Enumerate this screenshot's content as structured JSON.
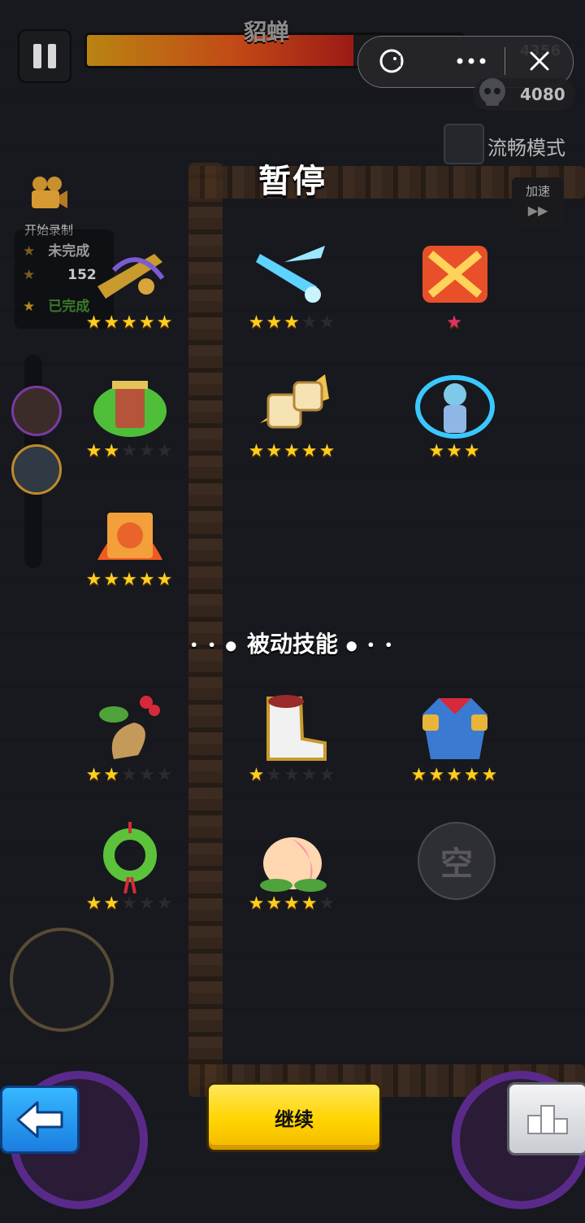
{
  "hud": {
    "boss_name": "貂蝉",
    "boss_hp_fraction": 0.71,
    "coin_count": "4356",
    "kill_count": "4080",
    "smooth_mode_label": "流畅模式",
    "speed_label": "加速",
    "speed_arrows": "▶▶"
  },
  "recording": {
    "label": "开始录制",
    "incomplete_label": "未完成",
    "count": "152",
    "complete_label": "已完成"
  },
  "pause_title": "暂停",
  "active_skills": [
    {
      "name": "golden-crossbow",
      "stars": 5,
      "max": 5
    },
    {
      "name": "ice-blade",
      "stars": 3,
      "max": 5
    },
    {
      "name": "fire-crossed-swords",
      "stars": 1,
      "max": 1,
      "star_color": "#e0326a"
    },
    {
      "name": "green-flame-totem",
      "stars": 2,
      "max": 5
    },
    {
      "name": "golden-dice",
      "stars": 5,
      "max": 5
    },
    {
      "name": "taoist-summon",
      "stars": 3,
      "max": 3
    },
    {
      "name": "fire-scroll",
      "stars": 5,
      "max": 5
    }
  ],
  "passive_title": "被动技能",
  "passive_dots_left": "• • ●",
  "passive_dots_right": "● • •",
  "passive_skills": [
    {
      "name": "ginseng-root",
      "stars": 2,
      "max": 5
    },
    {
      "name": "boots",
      "stars": 1,
      "max": 5
    },
    {
      "name": "armor",
      "stars": 5,
      "max": 5
    },
    {
      "name": "jade-pendant",
      "stars": 2,
      "max": 5
    },
    {
      "name": "peach",
      "stars": 4,
      "max": 5
    }
  ],
  "empty_slot_label": "空",
  "buttons": {
    "continue_label": "继续"
  },
  "colors": {
    "star_on": "#ffcf1f",
    "star_off": "#2a2b30",
    "continue_button": "#ffd400",
    "back_button": "#1a7ee0"
  }
}
